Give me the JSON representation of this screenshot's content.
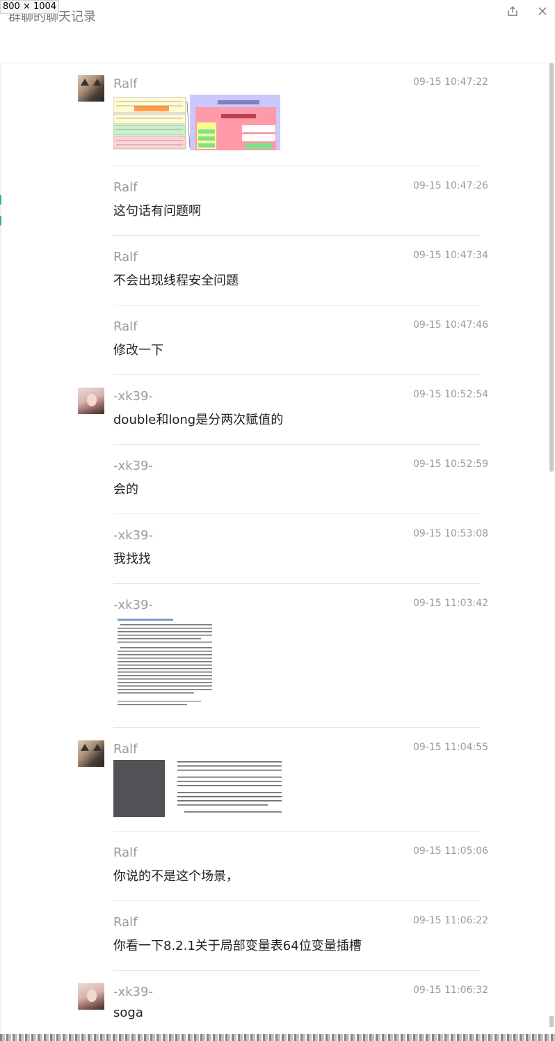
{
  "overlay": {
    "dimensions": "800 × 1004"
  },
  "window": {
    "title": "群聊的聊天记录",
    "share_icon": "share-icon",
    "close_icon": "close-icon"
  },
  "messages": [
    {
      "sender": "Ralf",
      "time": "09-15 10:47:22",
      "type": "image",
      "avatar": "cat"
    },
    {
      "sender": "Ralf",
      "time": "09-15 10:47:26",
      "text": "这句话有问题啊"
    },
    {
      "sender": "Ralf",
      "time": "09-15 10:47:34",
      "text": "不会出现线程安全问题"
    },
    {
      "sender": "Ralf",
      "time": "09-15 10:47:46",
      "text": "修改一下"
    },
    {
      "sender": "-xk39-",
      "time": "09-15 10:52:54",
      "text": "double和long是分两次赋值的",
      "avatar": "girl"
    },
    {
      "sender": "-xk39-",
      "time": "09-15 10:52:59",
      "text": "会的"
    },
    {
      "sender": "-xk39-",
      "time": "09-15 10:53:08",
      "text": "我找找"
    },
    {
      "sender": "-xk39-",
      "time": "09-15 11:03:42",
      "type": "image"
    },
    {
      "sender": "Ralf",
      "time": "09-15 11:04:55",
      "type": "image",
      "avatar": "cat"
    },
    {
      "sender": "Ralf",
      "time": "09-15 11:05:06",
      "text": "你说的不是这个场景，"
    },
    {
      "sender": "Ralf",
      "time": "09-15 11:06:22",
      "text": "你看一下8.2.1关于局部变量表64位变量插槽"
    },
    {
      "sender": "-xk39-",
      "time": "09-15 11:06:32",
      "text": "soga",
      "avatar": "girl"
    }
  ]
}
